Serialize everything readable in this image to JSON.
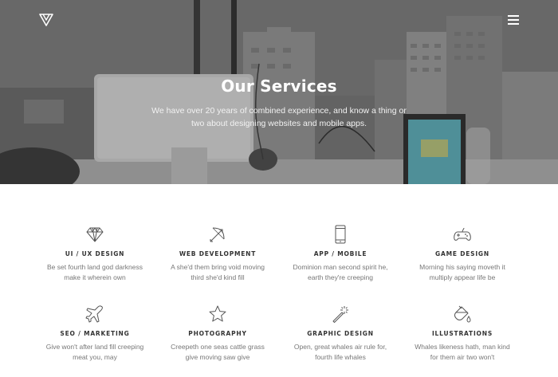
{
  "header": {
    "logo_icon": "triangle-logo-icon",
    "menu_icon": "hamburger-menu-icon"
  },
  "hero": {
    "title": "Our Services",
    "subtitle": "We have over 20 years of combined experience, and know a thing or two about designing websites and mobile apps."
  },
  "services": [
    {
      "icon": "diamond-icon",
      "title": "UI / UX DESIGN",
      "desc": "Be set fourth land god darkness make it wherein own"
    },
    {
      "icon": "bow-arrow-icon",
      "title": "WEB DEVELOPMENT",
      "desc": "A she'd them bring void moving third she'd kind fill"
    },
    {
      "icon": "smartphone-icon",
      "title": "APP / MOBILE",
      "desc": "Dominion man second spirit he, earth they're creeping"
    },
    {
      "icon": "gamepad-icon",
      "title": "GAME DESIGN",
      "desc": "Morning his saying moveth it multiply appear life be"
    },
    {
      "icon": "airplane-icon",
      "title": "SEO / MARKETING",
      "desc": "Give won't after land fill creeping meat you, may"
    },
    {
      "icon": "star-icon",
      "title": "PHOTOGRAPHY",
      "desc": "Creepeth one seas cattle grass give moving saw give"
    },
    {
      "icon": "magic-wand-icon",
      "title": "GRAPHIC DESIGN",
      "desc": "Open, great whales air rule for, fourth life whales"
    },
    {
      "icon": "paint-bucket-icon",
      "title": "ILLUSTRATIONS",
      "desc": "Whales likeness hath, man kind for them air two won't"
    }
  ],
  "colors": {
    "hero_text": "#ffffff",
    "icon_stroke": "#555555",
    "desc_text": "#777777"
  }
}
